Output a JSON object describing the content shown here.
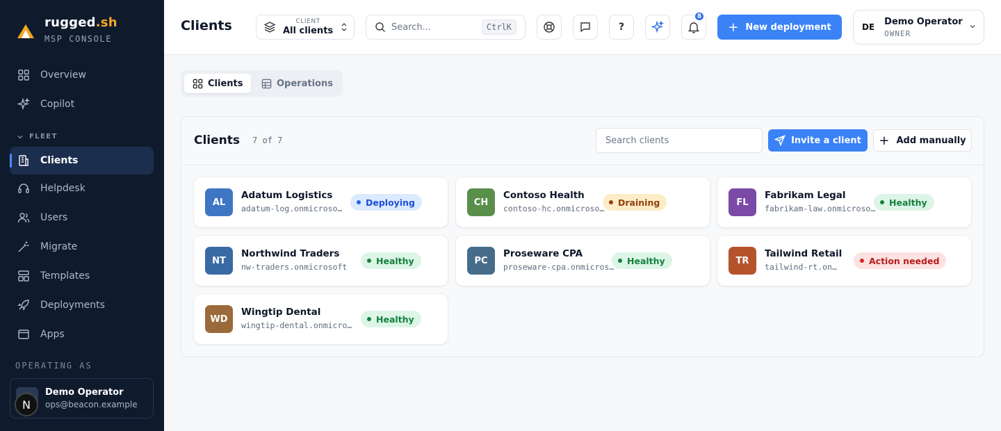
{
  "brand": {
    "name": "rugged",
    "name_accent": ".sh",
    "subtitle": "MSP CONSOLE"
  },
  "sidebar": {
    "items": [
      {
        "label": "Overview",
        "icon": "grid-icon"
      },
      {
        "label": "Copilot",
        "icon": "sparkle-icon"
      },
      {
        "label": "Clients",
        "icon": "building-icon",
        "active": true
      },
      {
        "label": "Helpdesk",
        "icon": "headset-icon"
      },
      {
        "label": "Users",
        "icon": "users-icon"
      },
      {
        "label": "Migrate",
        "icon": "wand-icon"
      },
      {
        "label": "Templates",
        "icon": "template-icon"
      },
      {
        "label": "Deployments",
        "icon": "rocket-icon"
      },
      {
        "label": "Apps",
        "icon": "window-icon"
      }
    ],
    "section_fleet": "FLEET",
    "operating_label": "OPERATING AS",
    "operator": {
      "name": "Demo Operator",
      "email": "ops@beacon.example",
      "badge": "N"
    }
  },
  "header": {
    "title": "Clients",
    "client_select": {
      "label": "CLIENT",
      "value": "All clients"
    },
    "search_placeholder": "Search...",
    "search_shortcut": "CtrlK",
    "help_label": "?",
    "notification_count": "8",
    "new_deployment": "New deployment",
    "user": {
      "initials": "DE",
      "name": "Demo Operator",
      "role": "OWNER"
    }
  },
  "view_tabs": [
    {
      "label": "Clients",
      "active": true
    },
    {
      "label": "Operations",
      "active": false
    }
  ],
  "panel": {
    "title": "Clients",
    "count": "7 of 7",
    "search_placeholder": "Search clients",
    "invite_label": "Invite a client",
    "add_label": "Add manually"
  },
  "clients": [
    {
      "initials": "AL",
      "name": "Adatum Logistics",
      "domain": "adatum-log.onmicrosoft.com",
      "status": "Deploying",
      "avatar_color": "#3f76c4"
    },
    {
      "initials": "CH",
      "name": "Contoso Health",
      "domain": "contoso-hc.onmicrosoft.com",
      "status": "Draining",
      "avatar_color": "#5a8f4b"
    },
    {
      "initials": "FL",
      "name": "Fabrikam Legal",
      "domain": "fabrikam-law.onmicrosoft.com",
      "status": "Healthy",
      "avatar_color": "#7a4aa6"
    },
    {
      "initials": "NT",
      "name": "Northwind Traders",
      "domain": "nw-traders.onmicrosoft",
      "status": "Healthy",
      "avatar_color": "#3a6aa3"
    },
    {
      "initials": "PC",
      "name": "Proseware CPA",
      "domain": "proseware-cpa.onmicrosoft.com",
      "status": "Healthy",
      "avatar_color": "#466c8a"
    },
    {
      "initials": "TR",
      "name": "Tailwind Retail",
      "domain": "tailwind-rt.onmicrosoft.com",
      "status": "Action needed",
      "avatar_color": "#b5532d"
    },
    {
      "initials": "WD",
      "name": "Wingtip Dental",
      "domain": "wingtip-dental.onmicrosoft.com",
      "status": "Healthy",
      "avatar_color": "#9b6a3a"
    }
  ],
  "status_styles": {
    "Deploying": {
      "bg": "#dbeafe",
      "fg": "#1d4ed8",
      "dot": "#2563eb"
    },
    "Draining": {
      "bg": "#fdecc8",
      "fg": "#92400e",
      "dot": "#92400e"
    },
    "Healthy": {
      "bg": "#dcf5e7",
      "fg": "#15803d",
      "dot": "#15803d"
    },
    "Action needed": {
      "bg": "#fde2e2",
      "fg": "#b91c1c",
      "dot": "#dc2626"
    }
  }
}
